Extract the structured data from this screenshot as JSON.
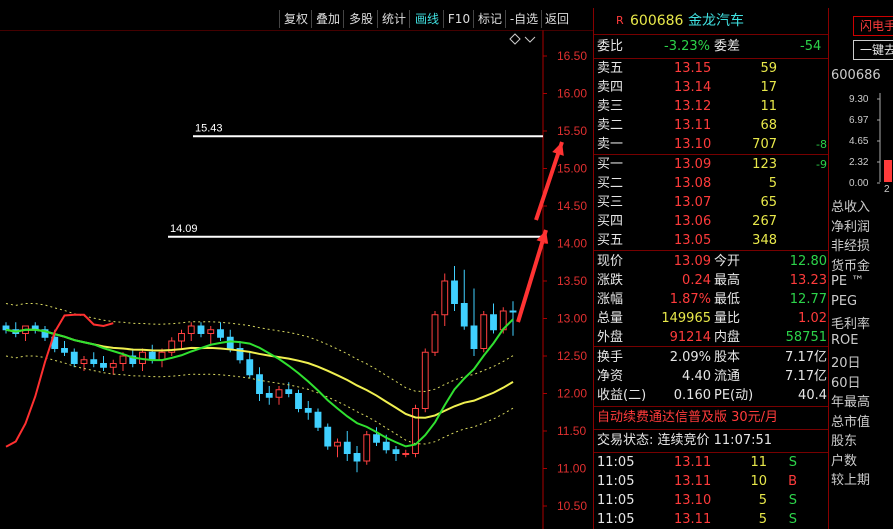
{
  "toolbar": {
    "buttons": [
      "复权",
      "叠加",
      "多股",
      "统计",
      "画线",
      "F10",
      "标记",
      "-自选",
      "返回"
    ],
    "active": "画线"
  },
  "chart_data": {
    "type": "candlestick",
    "ylim": [
      10.5,
      16.5
    ],
    "yticks": [
      "16.50",
      "16.00",
      "15.50",
      "15.00",
      "14.50",
      "14.00",
      "13.50",
      "13.00",
      "12.50",
      "12.00",
      "11.50",
      "11.00",
      "10.50"
    ],
    "lines": [
      {
        "label": "15.43",
        "value": 15.43
      },
      {
        "label": "14.09",
        "value": 14.09
      }
    ],
    "candles": [
      [
        12.9,
        12.95,
        12.8,
        12.85
      ],
      [
        12.85,
        12.95,
        12.75,
        12.8
      ],
      [
        12.8,
        12.9,
        12.7,
        12.9
      ],
      [
        12.9,
        12.95,
        12.8,
        12.85
      ],
      [
        12.85,
        12.9,
        12.7,
        12.75
      ],
      [
        12.75,
        12.85,
        12.55,
        12.6
      ],
      [
        12.6,
        12.7,
        12.5,
        12.55
      ],
      [
        12.55,
        12.6,
        12.35,
        12.4
      ],
      [
        12.4,
        12.5,
        12.3,
        12.45
      ],
      [
        12.45,
        12.55,
        12.35,
        12.4
      ],
      [
        12.4,
        12.5,
        12.3,
        12.35
      ],
      [
        12.35,
        12.45,
        12.25,
        12.4
      ],
      [
        12.4,
        12.55,
        12.3,
        12.5
      ],
      [
        12.5,
        12.6,
        12.35,
        12.4
      ],
      [
        12.4,
        12.6,
        12.3,
        12.55
      ],
      [
        12.55,
        12.65,
        12.4,
        12.45
      ],
      [
        12.45,
        12.6,
        12.35,
        12.55
      ],
      [
        12.55,
        12.75,
        12.5,
        12.7
      ],
      [
        12.7,
        12.85,
        12.6,
        12.8
      ],
      [
        12.8,
        12.95,
        12.7,
        12.9
      ],
      [
        12.9,
        12.95,
        12.75,
        12.8
      ],
      [
        12.8,
        12.9,
        12.65,
        12.85
      ],
      [
        12.85,
        12.95,
        12.7,
        12.75
      ],
      [
        12.75,
        12.85,
        12.55,
        12.6
      ],
      [
        12.6,
        12.7,
        12.4,
        12.45
      ],
      [
        12.45,
        12.55,
        12.2,
        12.25
      ],
      [
        12.25,
        12.35,
        11.9,
        12.0
      ],
      [
        12.0,
        12.1,
        11.85,
        11.95
      ],
      [
        11.95,
        12.1,
        11.85,
        12.05
      ],
      [
        12.05,
        12.15,
        11.95,
        12.0
      ],
      [
        12.0,
        12.05,
        11.75,
        11.8
      ],
      [
        11.8,
        11.9,
        11.65,
        11.75
      ],
      [
        11.75,
        11.8,
        11.5,
        11.55
      ],
      [
        11.55,
        11.6,
        11.25,
        11.3
      ],
      [
        11.3,
        11.4,
        11.15,
        11.35
      ],
      [
        11.35,
        11.5,
        11.1,
        11.2
      ],
      [
        11.2,
        11.3,
        10.95,
        11.1
      ],
      [
        11.1,
        11.5,
        11.05,
        11.45
      ],
      [
        11.45,
        11.55,
        11.3,
        11.35
      ],
      [
        11.35,
        11.45,
        11.2,
        11.25
      ],
      [
        11.25,
        11.3,
        11.1,
        11.2
      ],
      [
        11.2,
        11.25,
        11.15,
        11.2
      ],
      [
        11.2,
        11.85,
        11.15,
        11.8
      ],
      [
        11.8,
        12.6,
        11.75,
        12.55
      ],
      [
        12.55,
        13.1,
        12.5,
        13.05
      ],
      [
        13.05,
        13.6,
        12.9,
        13.5
      ],
      [
        13.5,
        13.7,
        13.1,
        13.2
      ],
      [
        13.2,
        13.65,
        12.85,
        12.9
      ],
      [
        12.9,
        13.4,
        12.5,
        12.6
      ],
      [
        12.6,
        13.1,
        12.55,
        13.05
      ],
      [
        13.05,
        13.2,
        12.8,
        12.85
      ],
      [
        12.85,
        13.15,
        12.8,
        13.1
      ],
      [
        13.1,
        13.23,
        12.77,
        13.09
      ]
    ]
  },
  "quote": {
    "code": "600686",
    "name": "金龙汽车",
    "weibi_label": "委比",
    "weibi": "-3.23%",
    "weicha_label": "委差",
    "weicha": "-54",
    "asks": [
      {
        "label": "卖五",
        "price": "13.15",
        "vol": "59",
        "chg": ""
      },
      {
        "label": "卖四",
        "price": "13.14",
        "vol": "17",
        "chg": ""
      },
      {
        "label": "卖三",
        "price": "13.12",
        "vol": "11",
        "chg": ""
      },
      {
        "label": "卖二",
        "price": "13.11",
        "vol": "68",
        "chg": ""
      },
      {
        "label": "卖一",
        "price": "13.10",
        "vol": "707",
        "chg": "-8"
      }
    ],
    "bids": [
      {
        "label": "买一",
        "price": "13.09",
        "vol": "123",
        "chg": "-9"
      },
      {
        "label": "买二",
        "price": "13.08",
        "vol": "5",
        "chg": ""
      },
      {
        "label": "买三",
        "price": "13.07",
        "vol": "65",
        "chg": ""
      },
      {
        "label": "买四",
        "price": "13.06",
        "vol": "267",
        "chg": ""
      },
      {
        "label": "买五",
        "price": "13.05",
        "vol": "348",
        "chg": ""
      }
    ],
    "stats": [
      {
        "l1": "现价",
        "v1": "13.09",
        "c1": "red",
        "l2": "今开",
        "v2": "12.80",
        "c2": "green"
      },
      {
        "l1": "涨跌",
        "v1": "0.24",
        "c1": "red",
        "l2": "最高",
        "v2": "13.23",
        "c2": "red"
      },
      {
        "l1": "涨幅",
        "v1": "1.87%",
        "c1": "red",
        "l2": "最低",
        "v2": "12.77",
        "c2": "green"
      },
      {
        "l1": "总量",
        "v1": "149965",
        "c1": "yellow",
        "l2": "量比",
        "v2": "1.02",
        "c2": "red"
      },
      {
        "l1": "外盘",
        "v1": "91214",
        "c1": "red",
        "l2": "内盘",
        "v2": "58751",
        "c2": "green"
      }
    ],
    "stats2": [
      {
        "l1": "换手",
        "v1": "2.09%",
        "l2": "股本",
        "v2": "7.17亿"
      },
      {
        "l1": "净资",
        "v1": "4.40",
        "l2": "流通",
        "v2": "7.17亿"
      },
      {
        "l1": "收益(二)",
        "v1": "0.160",
        "l2": "PE(动)",
        "v2": "40.4"
      }
    ],
    "ad": "自动续费通达信普及版 30元/月",
    "status": "交易状态: 连续竞价 11:07:51",
    "ticks": [
      {
        "t": "11:05",
        "p": "13.11",
        "v": "11",
        "d": "S"
      },
      {
        "t": "11:05",
        "p": "13.11",
        "v": "10",
        "d": "B"
      },
      {
        "t": "11:05",
        "p": "13.10",
        "v": "5",
        "d": "S"
      },
      {
        "t": "11:05",
        "p": "13.11",
        "v": "5",
        "d": "S"
      }
    ]
  },
  "side": {
    "btn1": "闪电手",
    "btn2": "一键去",
    "code": "600686",
    "mini_ticks": [
      "9.30",
      "6.97",
      "4.65",
      "2.32",
      "0.00"
    ],
    "mini_x": "2",
    "labels": [
      "总收入",
      "净利润",
      "非经损",
      "货币金",
      "PE ™",
      "PEG",
      "毛利率",
      "ROE",
      "20日",
      "60日",
      "年最高",
      "总市值",
      "股东",
      "户数",
      "较上期"
    ]
  }
}
